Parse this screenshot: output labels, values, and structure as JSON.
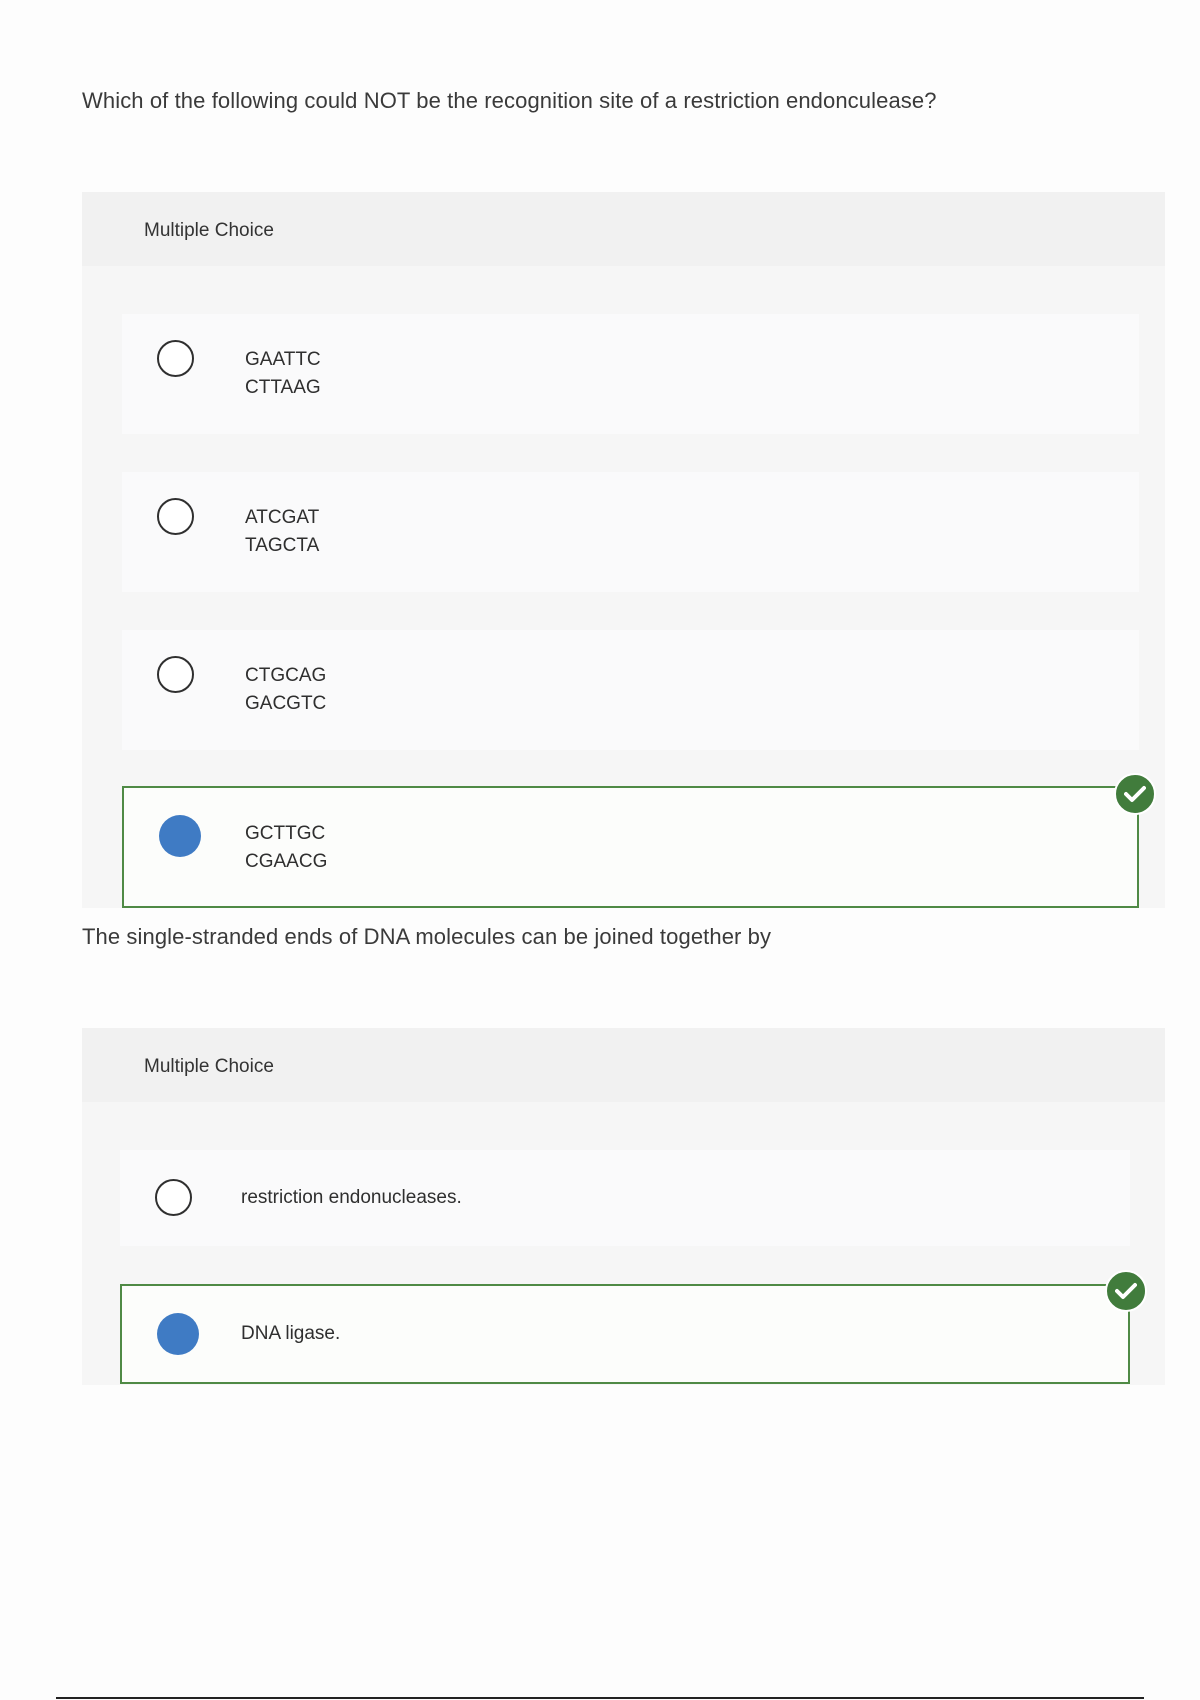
{
  "questions": [
    {
      "prompt": "Which of the following could NOT be the recognition site of a restriction endonculease?",
      "type_label": "Multiple Choice",
      "options": [
        {
          "line1": "GAATTC",
          "line2": "CTTAAG",
          "selected": false
        },
        {
          "line1": "ATCGAT",
          "line2": "TAGCTA",
          "selected": false
        },
        {
          "line1": "CTGCAG",
          "line2": "GACGTC",
          "selected": false
        },
        {
          "line1": "GCTTGC",
          "line2": "CGAACG",
          "selected": true,
          "correct": true
        }
      ]
    },
    {
      "prompt": "The single-stranded ends of DNA molecules can be joined together by",
      "type_label": "Multiple Choice",
      "options": [
        {
          "label": "restriction endonucleases.",
          "selected": false
        },
        {
          "label": "DNA ligase.",
          "selected": true,
          "correct": true
        }
      ]
    }
  ],
  "colors": {
    "selected_radio": "#3f7bc4",
    "correct_border": "#4f8a45",
    "correct_badge": "#417c3c"
  },
  "icons": {
    "correct": "check-circle-icon"
  }
}
